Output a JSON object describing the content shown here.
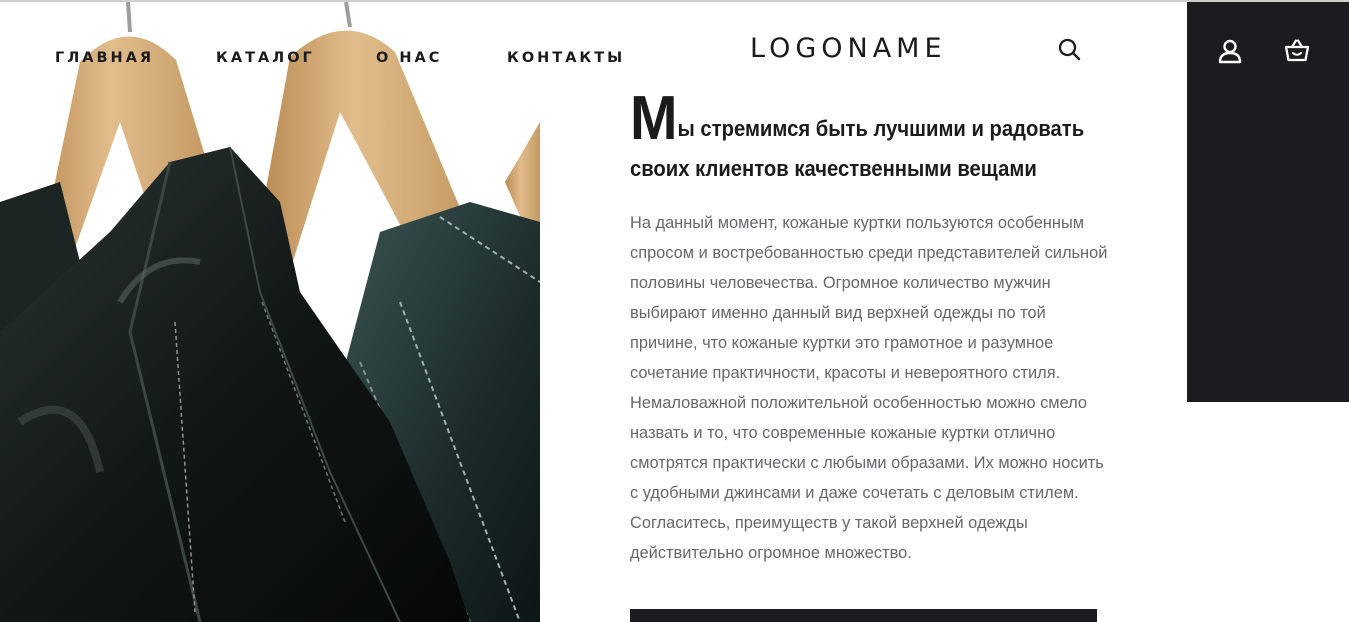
{
  "colors": {
    "dark": "#1c1b20",
    "text_dark": "#1b1b1e",
    "text_gray": "#67666c",
    "background": "#ffffff"
  },
  "nav": {
    "items": [
      {
        "label": "ГЛАВНАЯ"
      },
      {
        "label": "КАТАЛОГ"
      },
      {
        "label": "О НАС"
      },
      {
        "label": "КОНТАКТЫ"
      }
    ]
  },
  "logo": {
    "text": "LOGONAME"
  },
  "header": {
    "search_icon": "search-icon",
    "account_icon": "user-icon",
    "cart_icon": "shopping-basket-icon"
  },
  "hero": {
    "image_subject": "leather jackets on wooden hangers"
  },
  "content": {
    "headline": {
      "initial": "М",
      "line1_rest": "ы стремимся быть лучшими и радовать",
      "line2": "своих клиентов качественными вещами"
    },
    "paragraph_lines": [
      "На данный момент, кожаные куртки пользуются особенным",
      "спросом и востребованностью среди представителей сильной",
      "половины человечества. Огромное количество мужчин",
      "выбирают именно данный вид верхней одежды по той",
      "причине, что кожаные куртки это грамотное и разумное",
      "сочетание практичности, красоты и невероятного стиля.",
      "Немаловажной положительной особенностью можно смело",
      "назвать и то, что современные кожаные куртки отлично",
      "смотрятся практически с любыми образами. Их можно носить",
      "с удобными джинсами и даже сочетать с деловым стилем.",
      "Согласитесь, преимуществ у такой верхней одежды",
      "действительно огромное множество."
    ]
  }
}
